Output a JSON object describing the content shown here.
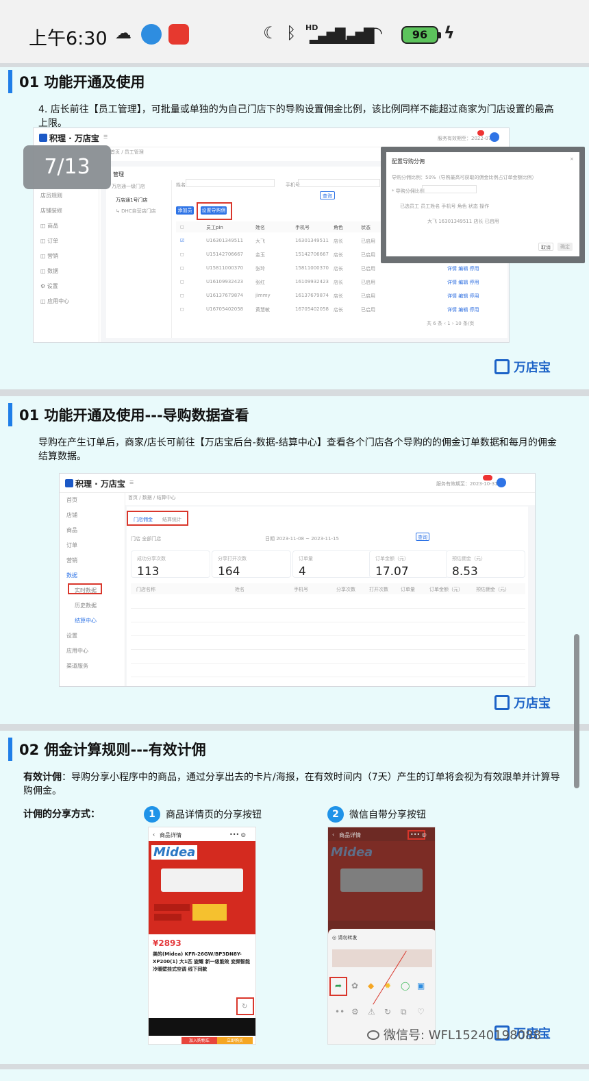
{
  "status_bar": {
    "time": "上午6:30",
    "network": "HD",
    "battery": "96"
  },
  "page_indicator": "7/13",
  "brand": "万店宝",
  "slide1": {
    "title": "01 功能开通及使用",
    "body": "4. 店长前往【员工管理】，可批量或单独的为自己门店下的导购设置佣金比例，该比例同样不能超过商家为门店设置的最高上限。",
    "app_logo": "积理 · 万店宝",
    "breadcrumb": "首页 / 员工管理",
    "btn_set_commission": "设置导购佣金",
    "btn_add": "添加员工",
    "table_header": [
      "员工pin",
      "姓名",
      "手机号",
      "角色",
      "状态"
    ],
    "rows": [
      [
        "U16301349511",
        "大飞",
        "16301349511",
        "店长",
        "已启用"
      ],
      [
        "U15142706667",
        "金玉",
        "15142706667",
        "店长",
        "已启用"
      ],
      [
        "U15811000370",
        "张玲",
        "15811000370",
        "店长",
        "已启用"
      ],
      [
        "U16109932423",
        "张红",
        "16109932423",
        "店长",
        "已启用"
      ],
      [
        "U16137679874",
        "jimmy",
        "16137679874",
        "店长",
        "已启用"
      ],
      [
        "U16705402058",
        "黄慧敏",
        "16705402058",
        "店长",
        "已启用"
      ]
    ],
    "row_actions": "详情 编辑 停用",
    "modal_title": "配置导购分佣",
    "modal_cancel": "取消",
    "modal_ok": "确定"
  },
  "slide2": {
    "title": "01 功能开通及使用---导购数据查看",
    "body": "导购在产生订单后，商家/店长可前往【万店宝后台-数据-结算中心】查看各个门店各个导购的的佣金订单数据和每月的佣金结算数据。",
    "app_logo": "积理 · 万店宝",
    "breadcrumb": "首页 / 数据 / 结算中心",
    "tab1": "门店佣金",
    "tab2": "结算统计",
    "sidebar": [
      "首页",
      "店铺",
      "商品",
      "订单",
      "营销",
      "数据",
      "实时数据",
      "历史数据",
      "结算中心",
      "设置",
      "应用中心",
      "渠道服务"
    ],
    "stats": [
      {
        "label": "成功分享次数",
        "value": "113"
      },
      {
        "label": "分享打开次数",
        "value": "164"
      },
      {
        "label": "订单量",
        "value": "4"
      },
      {
        "label": "订单金额（元）",
        "value": "17.07"
      },
      {
        "label": "预估佣金（元）",
        "value": "8.53"
      }
    ],
    "table_header": [
      "门店名称",
      "姓名",
      "手机号",
      "分享次数",
      "打开次数",
      "订单量",
      "订单金额（元）",
      "预估佣金（元）"
    ],
    "search_btn": "查询"
  },
  "slide3": {
    "title": "02 佣金计算规则---有效计佣",
    "body_bold": "有效计佣",
    "body": "：导购分享小程序中的商品，通过分享出去的卡片/海报，在有效时间内（7天）产生的订单将会视为有效跟单并计算导购佣金。",
    "share_methods_label": "计佣的分享方式：",
    "step1_no": "1",
    "step1_label": "商品详情页的分享按钮",
    "step2_no": "2",
    "step2_label": "微信自带分享按钮",
    "phone_title": "商品详情",
    "midea": "Midea",
    "price": "¥2893",
    "product_name": "美的(Midea) KFR-26GW/BP3DN8Y-XP200(1) 大1匹 旋耀 新一级能效 变频智能冷暖壁挂式空调 线下同款",
    "buy_now": "立即购买",
    "add_cart": "加入购物车"
  },
  "watermark": "微信号: WFL15240198088"
}
